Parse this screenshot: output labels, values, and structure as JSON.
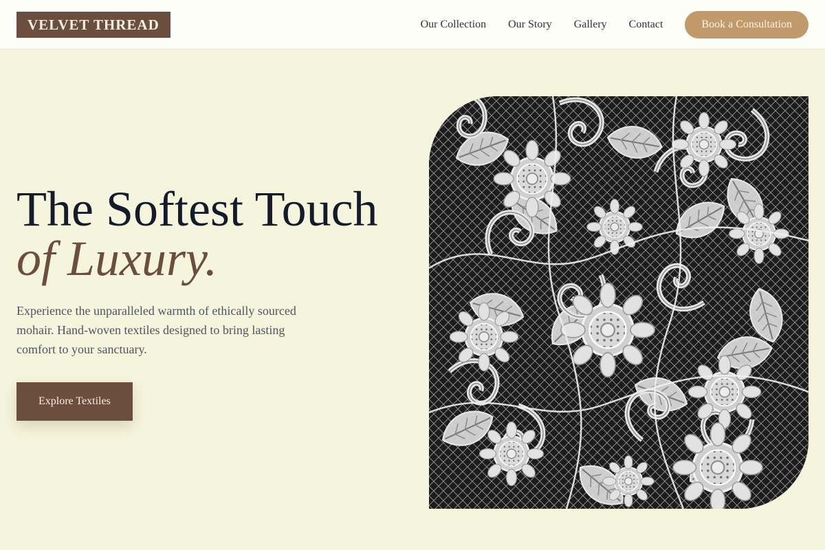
{
  "brand": {
    "name": "VELVET THREAD"
  },
  "nav": {
    "links": [
      "Our Collection",
      "Our Story",
      "Gallery",
      "Contact"
    ],
    "cta": "Book a Consultation"
  },
  "hero": {
    "headline_line1": "The Softest Touch",
    "headline_line2": "of Luxury.",
    "subtext": "Experience the unparalleled warmth of ethically sourced mohair. Hand-woven textiles designed to bring lasting comfort to your sanctuary.",
    "button_label": "Explore Textiles",
    "image_subject": "black-and-white floral lace textile"
  },
  "colors": {
    "page_background": "#f5f4dc",
    "header_background": "#fdfdf8",
    "brand_brown": "#6b4e3d",
    "accent_tan": "#c09a6b",
    "headline_dark": "#141b2b",
    "body_text": "#4c5563"
  }
}
